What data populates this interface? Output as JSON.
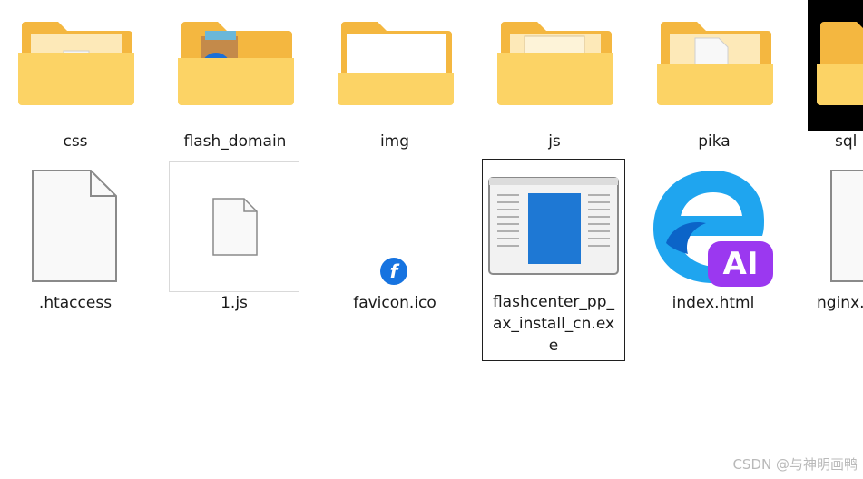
{
  "files": [
    {
      "label": "css",
      "icon": "folder-icon"
    },
    {
      "label": "flash_domain",
      "icon": "folder-with-flash-icon"
    },
    {
      "label": "img",
      "icon": "folder-icon"
    },
    {
      "label": "js",
      "icon": "folder-icon"
    },
    {
      "label": "pika",
      "icon": "folder-icon"
    },
    {
      "label": "sql",
      "icon": "folder-icon"
    },
    {
      "label": ".htaccess",
      "icon": "blank-file-icon"
    },
    {
      "label": "1.js",
      "icon": "js-file-icon"
    },
    {
      "label": "favicon.ico",
      "icon": "flash-icon"
    },
    {
      "label": "flashcenter_pp_ax_install_cn.exe",
      "label_lines": [
        "flashcenter_pp_",
        "ax_install_cn.ex",
        "e"
      ],
      "icon": "installer-exe-icon",
      "selected": true
    },
    {
      "label": "index.html",
      "icon": "ai-browser-icon"
    },
    {
      "label": "nginx.",
      "icon": "blank-file-icon"
    }
  ],
  "watermark": "CSDN @与神明画鸭",
  "colors": {
    "folder_back": "#f4b740",
    "folder_front": "#fcd365",
    "selection_border": "#1f1f1f"
  }
}
